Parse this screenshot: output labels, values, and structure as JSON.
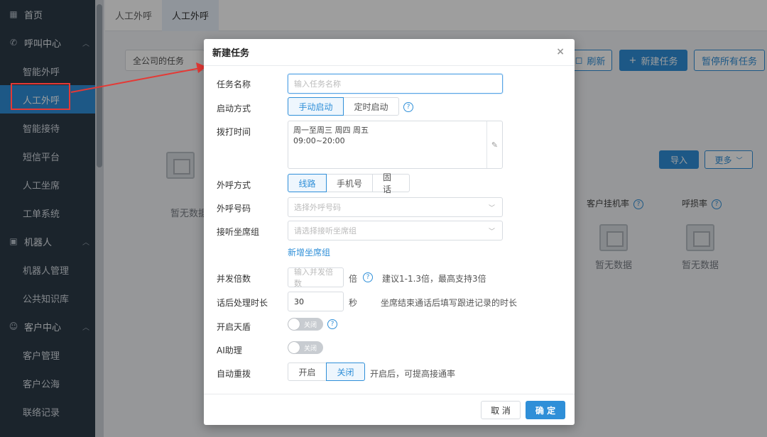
{
  "sidebar": {
    "home": "首页",
    "groups": [
      {
        "label": "呼叫中心",
        "items": [
          "智能外呼",
          "人工外呼",
          "智能接待",
          "短信平台",
          "人工坐席",
          "工单系统"
        ]
      },
      {
        "label": "机器人",
        "items": [
          "机器人管理",
          "公共知识库"
        ]
      },
      {
        "label": "客户中心",
        "items": [
          "客户管理",
          "客户公海",
          "联络记录"
        ]
      }
    ],
    "active_item": "人工外呼"
  },
  "tabs": [
    "人工外呼",
    "人工外呼"
  ],
  "toolbar": {
    "company_select": "全公司的任务",
    "refresh": "刷新",
    "new_task": "新建任务",
    "pause_all": "暂停所有任务",
    "import": "导入",
    "more": "更多"
  },
  "background": {
    "empty_text": "暂无数据",
    "stat_hangup": "客户挂机率",
    "stat_loss": "呼损率"
  },
  "modal": {
    "title": "新建任务",
    "close": "×",
    "task_name": {
      "label": "任务名称",
      "placeholder": "输入任务名称"
    },
    "start_mode": {
      "label": "启动方式",
      "options": [
        "手动启动",
        "定时启动"
      ],
      "selected": "手动启动"
    },
    "dial_time": {
      "label": "拨打时间",
      "line1": "周一至周三 周四 周五",
      "line2": "09:00~20:00"
    },
    "call_mode": {
      "label": "外呼方式",
      "options": [
        "线路",
        "手机号",
        "固话"
      ],
      "selected": "线路"
    },
    "call_number": {
      "label": "外呼号码",
      "placeholder": "选择外呼号码"
    },
    "agent_group": {
      "label": "接听坐席组",
      "placeholder": "请选择接听坐席组",
      "add_link": "新增坐席组"
    },
    "concurrency": {
      "label": "并发倍数",
      "placeholder": "输入并发倍数",
      "unit": "倍",
      "hint": "建议1-1.3倍，最高支持3倍"
    },
    "after_call": {
      "label": "话后处理时长",
      "value": "30",
      "unit": "秒",
      "hint": "坐席结束通话后填写跟进记录的时长"
    },
    "tiandun": {
      "label": "开启天盾",
      "state": "关闭"
    },
    "ai_assist": {
      "label": "AI助理",
      "state": "关闭"
    },
    "auto_redial": {
      "label": "自动重拨",
      "options": [
        "开启",
        "关闭"
      ],
      "selected": "关闭",
      "hint": "开启后，可提高接通率"
    },
    "cancel": "取 消",
    "confirm": "确 定"
  }
}
